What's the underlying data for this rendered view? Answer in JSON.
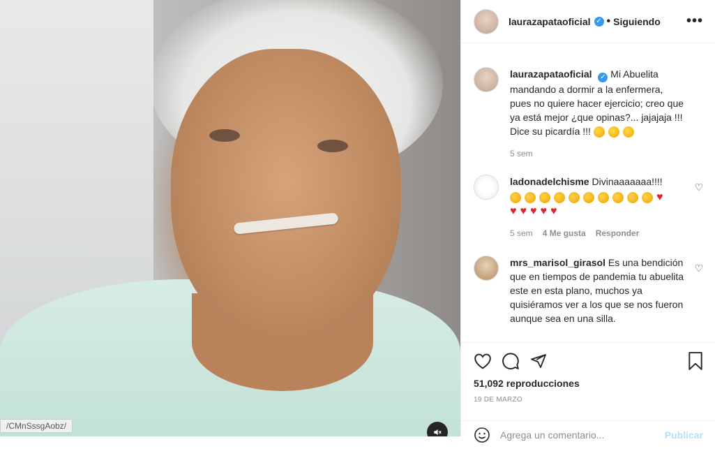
{
  "media": {
    "url_chip": "/CMnSssgAobz/",
    "mute_icon": "mute-icon"
  },
  "header": {
    "username": "laurazapataoficial",
    "follow_status": "Siguiendo",
    "more_icon": "more-options-icon"
  },
  "caption": {
    "username": "laurazapataoficial",
    "text": "Mi Abuelita mandando a dormir a la enfermera, pues no quiere hacer ejercicio; creo que ya está mejor ¿que opinas?... jajajaja !!! Dice su picardía !!!",
    "time": "5 sem"
  },
  "comments": [
    {
      "username": "ladonadelchisme",
      "text": "Divinaaaaaaa!!!!",
      "time": "5 sem",
      "likes": "4 Me gusta",
      "reply": "Responder"
    },
    {
      "username": "mrs_marisol_girasol",
      "text": "Es una bendición que en tiempos de pandemia tu abuelita este en esta plano, muchos ya quisiéramos ver a los que se nos fueron aunque sea en una silla."
    }
  ],
  "stats": {
    "views": "51,092 reproducciones",
    "date": "19 DE MARZO"
  },
  "add_comment": {
    "placeholder": "Agrega un comentario...",
    "publish": "Publicar"
  },
  "colors": {
    "link_blue": "#3897f0",
    "publish_disabled": "#b2dffc",
    "heart_red": "#e0232f"
  }
}
